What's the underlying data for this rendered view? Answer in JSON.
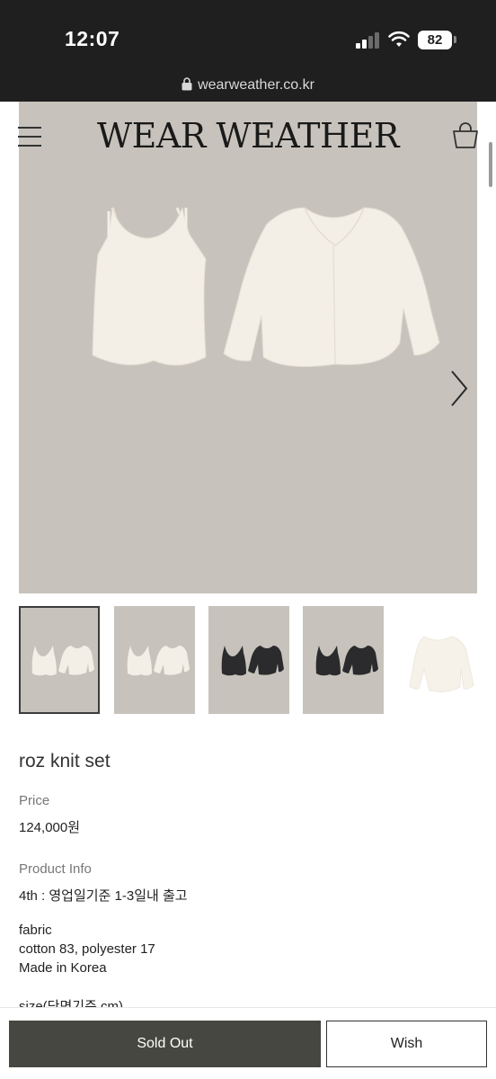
{
  "status_bar": {
    "time": "12:07",
    "battery": "82",
    "icons": [
      "signal-icon",
      "wifi-icon",
      "battery-icon"
    ]
  },
  "browser": {
    "url": "wearweather.co.kr",
    "icon": "lock-icon"
  },
  "header": {
    "brand": "WEAR WEATHER",
    "icons": [
      "menu-icon",
      "shopping-bag-icon"
    ]
  },
  "gallery": {
    "main_image": "cream knit camisole and cardigan set",
    "background_color": "#c7c3bc",
    "next_icon": "chevron-right-icon",
    "thumbnails": [
      {
        "variant": "cream",
        "selected": true
      },
      {
        "variant": "cream",
        "selected": false
      },
      {
        "variant": "black",
        "selected": false
      },
      {
        "variant": "black",
        "selected": false
      },
      {
        "variant": "cream cardigan",
        "selected": false
      }
    ]
  },
  "product": {
    "name": "roz knit set",
    "price_label": "Price",
    "price": "124,000원",
    "info_label": "Product Info",
    "shipping": "4th : 영업일기준 1-3일내 출고",
    "fabric_label": "fabric",
    "fabric": "cotton 83, polyester 17",
    "origin": "Made in Korea",
    "size_label": "size(단면기준 cm)"
  },
  "actions": {
    "sold_out": "Sold Out",
    "wish": "Wish",
    "sold_out_color": "#474741"
  }
}
